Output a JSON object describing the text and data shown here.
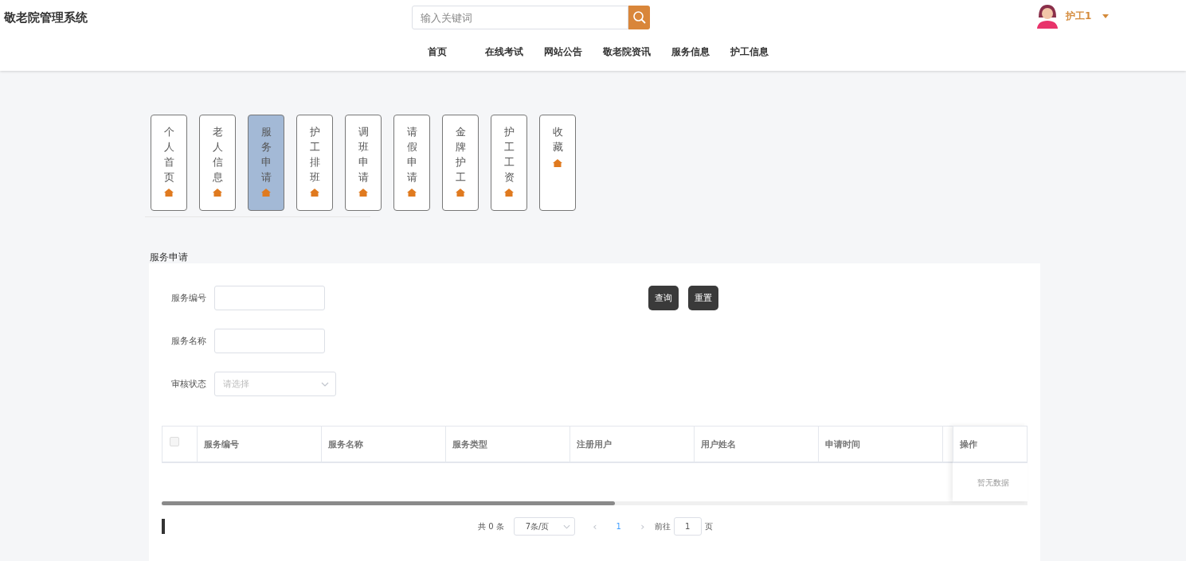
{
  "header": {
    "title": "敬老院管理系统",
    "search": {
      "placeholder": "输入关键词"
    },
    "user": {
      "name": "护工1"
    }
  },
  "nav": [
    {
      "label": "首页"
    },
    {
      "label": "在线考试"
    },
    {
      "label": "网站公告"
    },
    {
      "label": "敬老院资讯"
    },
    {
      "label": "服务信息"
    },
    {
      "label": "护工信息"
    }
  ],
  "menu_tiles": [
    {
      "label": "个人首页",
      "selected": false
    },
    {
      "label": "老人信息",
      "selected": false
    },
    {
      "label": "服务申请",
      "selected": true
    },
    {
      "label": "护工排班",
      "selected": false
    },
    {
      "label": "调班申请",
      "selected": false
    },
    {
      "label": "请假申请",
      "selected": false
    },
    {
      "label": "金牌护工",
      "selected": false
    },
    {
      "label": "护工工资",
      "selected": false
    },
    {
      "label": "收藏",
      "selected": false
    }
  ],
  "section_title": "服务申请",
  "filters": [
    {
      "kind": "input",
      "label": "服务编号"
    },
    {
      "kind": "input",
      "label": "服务名称"
    },
    {
      "kind": "select",
      "label": "审核状态",
      "placeholder": "请选择"
    }
  ],
  "buttons": [
    "查询",
    "重置"
  ],
  "table": {
    "checked_all": false,
    "columns": [
      "服务编号",
      "服务名称",
      "服务类型",
      "注册用户",
      "用户姓名",
      "申请时间"
    ],
    "action_column": "操作",
    "empty_text": "暂无数据"
  },
  "pagination": {
    "total": "共 0 条",
    "page_size": "7条/页",
    "prev": "‹",
    "current": "1",
    "next": "›",
    "goto_label": "前往",
    "goto_value": "1",
    "page_suffix": "页"
  }
}
